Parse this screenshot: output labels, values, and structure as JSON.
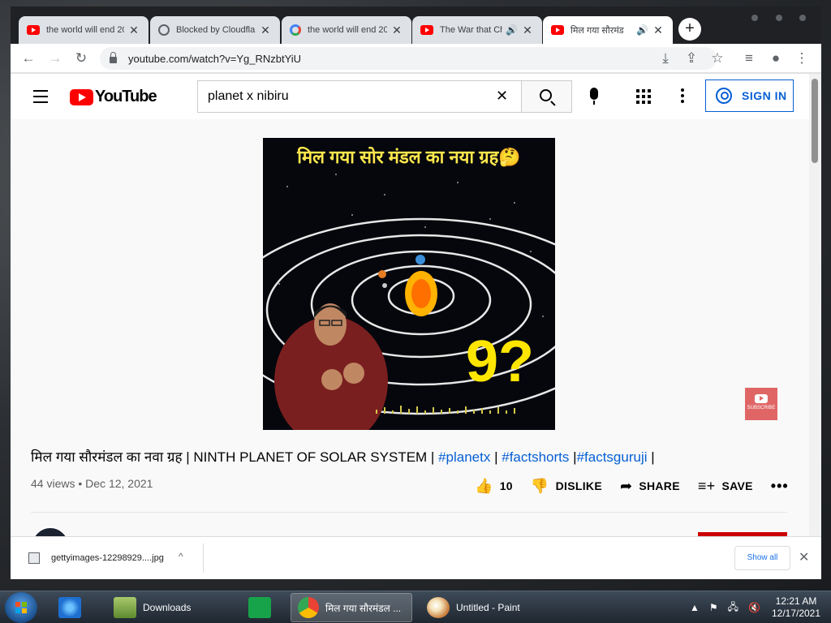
{
  "browser": {
    "tabs": [
      {
        "favicon": "youtube-icon",
        "title": "the world will end 20",
        "audio": false,
        "active": false
      },
      {
        "favicon": "globe-icon",
        "title": "Blocked by Cloudflare",
        "audio": false,
        "active": false
      },
      {
        "favicon": "google-icon",
        "title": "the world will end 20",
        "audio": false,
        "active": false
      },
      {
        "favicon": "youtube-icon",
        "title": "The War that Ch",
        "audio": true,
        "active": false
      },
      {
        "favicon": "youtube-icon",
        "title": "मिल गया सौरमंड",
        "audio": true,
        "active": true
      }
    ],
    "close_glyph": "✕",
    "speaker_glyph": "🔊",
    "new_tab_glyph": "+",
    "back_glyph": "←",
    "forward_glyph": "→",
    "reload_glyph": "↻",
    "url": "youtube.com/watch?v=Yg_RNzbtYiU",
    "toolbar_icons": [
      "install-icon",
      "share-icon",
      "star-icon",
      "media-icon",
      "profile-icon",
      "menu-icon"
    ],
    "toolbar_glyphs": {
      "install": "⤓",
      "share": "⇪",
      "star": "☆",
      "media": "≡",
      "profile": "●",
      "menu": "⋮"
    }
  },
  "youtube": {
    "logo_text": "YouTube",
    "search_value": "planet x nibiru",
    "clear_glyph": "✕",
    "sign_in_label": "SIGN IN",
    "video": {
      "thumbnail_headline": "मिल गया सोर मंडल का नया ग्रह🤔",
      "thumbnail_number": "9?",
      "subscribe_badge": "SUBSCRIBE"
    },
    "title_text": "मिल गया सौरमंडल का नवा ग्रह | NINTH PLANET OF SOLAR SYSTEM |",
    "hashtags": [
      "#planetx",
      "#factshorts",
      "#factsguruji"
    ],
    "sep": "|",
    "views": "44 views",
    "dot": "•",
    "date": "Dec 12, 2021",
    "actions": {
      "like_count": "10",
      "dislike_label": "DISLIKE",
      "share_label": "SHARE",
      "save_label": "SAVE",
      "more_glyph": "•••",
      "like_glyph": "👍",
      "dislike_glyph": "👎",
      "share_glyph": "➦",
      "save_glyph": "≡+"
    },
    "accent_red": "#ff0000",
    "link_blue": "#065fd4"
  },
  "downloads": {
    "filename": "gettyimages-12298929....jpg",
    "chevron_glyph": "^",
    "show_all_label": "Show all",
    "close_glyph": "✕"
  },
  "taskbar": {
    "items": [
      {
        "icon": "ie-icon",
        "label": ""
      },
      {
        "icon": "folder-icon",
        "label": "Downloads"
      },
      {
        "icon": "store-icon",
        "label": ""
      },
      {
        "icon": "chrome-icon",
        "label": "मिल गया सौरमंडल ..."
      },
      {
        "icon": "paint-icon",
        "label": "Untitled - Paint"
      }
    ],
    "tray_glyphs": [
      "▲",
      "⚑",
      "🖧",
      "🔇"
    ],
    "time": "12:21 AM",
    "date": "12/17/2021"
  }
}
